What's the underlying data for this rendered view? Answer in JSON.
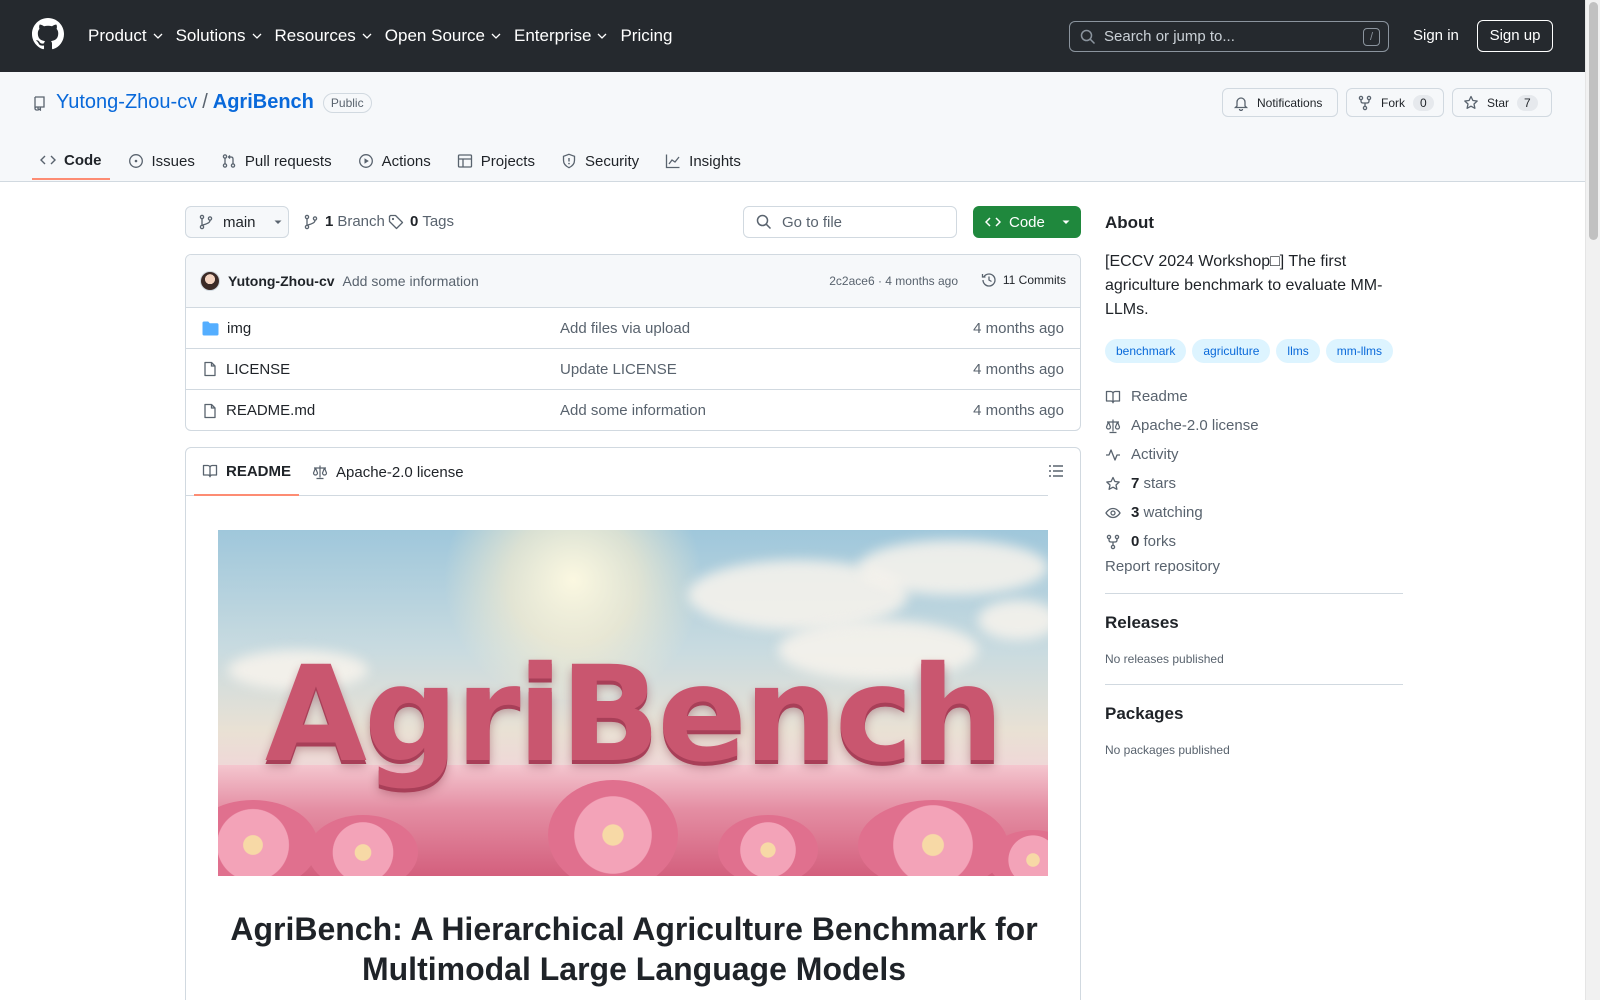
{
  "header": {
    "nav": [
      "Product",
      "Solutions",
      "Resources",
      "Open Source",
      "Enterprise",
      "Pricing"
    ],
    "search_placeholder": "Search or jump to...",
    "search_shortcut": "/",
    "sign_in": "Sign in",
    "sign_up": "Sign up"
  },
  "repo": {
    "owner": "Yutong-Zhou-cv",
    "separator": "/",
    "name": "AgriBench",
    "visibility": "Public",
    "notifications": "Notifications",
    "fork_label": "Fork",
    "fork_count": "0",
    "star_label": "Star",
    "star_count": "7",
    "tabs": [
      "Code",
      "Issues",
      "Pull requests",
      "Actions",
      "Projects",
      "Security",
      "Insights"
    ]
  },
  "toolbar": {
    "branch": "main",
    "branch_count": "1",
    "branch_label": "Branch",
    "tag_count": "0",
    "tag_label": "Tags",
    "goto_placeholder": "Go to file",
    "code_button": "Code"
  },
  "latest_commit": {
    "author": "Yutong-Zhou-cv",
    "message": "Add some information",
    "hash_time": "2c2ace6 · 4 months ago",
    "commits": "11 Commits"
  },
  "files": [
    {
      "name": "img",
      "type": "folder",
      "message": "Add files via upload",
      "time": "4 months ago"
    },
    {
      "name": "LICENSE",
      "type": "file",
      "message": "Update LICENSE",
      "time": "4 months ago"
    },
    {
      "name": "README.md",
      "type": "file",
      "message": "Add some information",
      "time": "4 months ago"
    }
  ],
  "readme": {
    "tab_readme": "README",
    "tab_license": "Apache-2.0 license",
    "hero_text": "AgriBench",
    "heading_line1": "AgriBench: A Hierarchical Agriculture Benchmark for",
    "heading_line2": "Multimodal Large Language Models"
  },
  "about": {
    "title": "About",
    "description": "[ECCV 2024 Workshop□] The first agriculture benchmark to evaluate MM-LLMs.",
    "topics": [
      "benchmark",
      "agriculture",
      "llms",
      "mm-llms"
    ],
    "readme": "Readme",
    "license": "Apache-2.0 license",
    "activity": "Activity",
    "stars_count": "7",
    "stars_label": "stars",
    "watching_count": "3",
    "watching_label": "watching",
    "forks_count": "0",
    "forks_label": "forks",
    "report": "Report repository"
  },
  "releases": {
    "title": "Releases",
    "empty": "No releases published"
  },
  "packages": {
    "title": "Packages",
    "empty": "No packages published"
  },
  "colors": {
    "header_bg": "#25292e",
    "link": "#0969da",
    "primary_button": "#1f883d",
    "active_tab_underline": "#fd8c73"
  }
}
